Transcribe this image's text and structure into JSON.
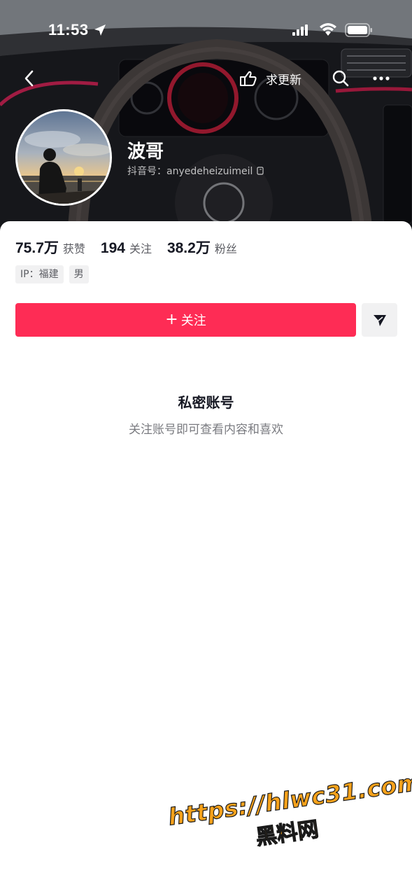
{
  "status_bar": {
    "time": "11:53"
  },
  "nav": {
    "update_label": "求更新"
  },
  "profile": {
    "name": "波哥",
    "douyin_id": "抖音号：anyedeheizuimeil"
  },
  "stats": [
    {
      "value": "75.7万",
      "label": "获赞"
    },
    {
      "value": "194",
      "label": "关注"
    },
    {
      "value": "38.2万",
      "label": "粉丝"
    }
  ],
  "tags": [
    "IP：福建",
    "男"
  ],
  "actions": {
    "follow_plus": "+",
    "follow_label": "关注"
  },
  "private": {
    "title": "私密账号",
    "subtitle": "关注账号即可查看内容和喜欢"
  },
  "watermark": {
    "url": "https://hlwc31.com",
    "name": "黑料网"
  },
  "icons": {
    "location": "location-arrow-icon",
    "signal": "cellular-signal-icon",
    "wifi": "wifi-icon",
    "battery": "battery-icon",
    "back": "chevron-left-icon",
    "update": "pointing-hand-icon",
    "search": "search-icon",
    "more": "more-dots-icon",
    "copy": "copy-icon",
    "share": "paper-plane-icon"
  },
  "colors": {
    "accent": "#fe2c55",
    "watermark": "#f7a21b"
  }
}
